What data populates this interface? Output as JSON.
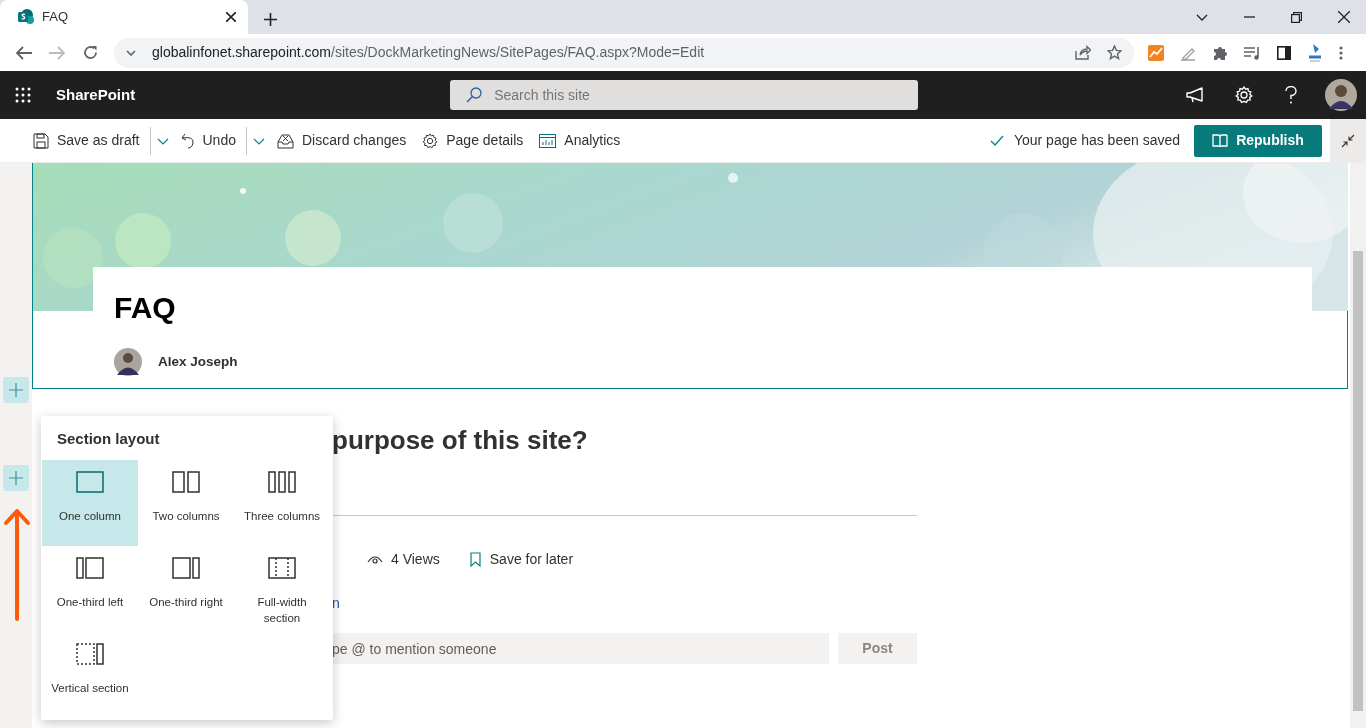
{
  "browser": {
    "tab_title": "FAQ",
    "url": "globalinfonet.sharepoint.com/sites/DockMarketingNews/SitePages/FAQ.aspx?Mode=Edit"
  },
  "suite_bar": {
    "app_name": "SharePoint",
    "search": {
      "placeholder": "Search this site"
    }
  },
  "command_bar": {
    "commands": [
      {
        "label": "Save as draft",
        "has_dropdown": true
      },
      {
        "label": "Undo",
        "has_dropdown": true
      },
      {
        "label": "Discard changes",
        "has_dropdown": false
      },
      {
        "label": "Page details",
        "has_dropdown": false
      },
      {
        "label": "Analytics",
        "has_dropdown": false
      }
    ],
    "status": "Your page has been saved",
    "primary_button": "Republish"
  },
  "page": {
    "title": "FAQ",
    "author": "Alex Joseph",
    "heading": "purpose of this site?",
    "views": "4 Views",
    "save_for_later": "Save for later",
    "link": "n",
    "comment": {
      "placeholder": "pe @ to mention someone"
    },
    "post_button": {
      "label": "Post",
      "disabled": true
    }
  },
  "section_layout": {
    "title": "Section layout",
    "options": [
      {
        "label": "One column",
        "selected": true
      },
      {
        "label": "Two columns",
        "selected": false
      },
      {
        "label": "Three columns",
        "selected": false
      },
      {
        "label": "One-third left",
        "selected": false
      },
      {
        "label": "One-third right",
        "selected": false
      },
      {
        "label": "Full-width section",
        "selected": false
      },
      {
        "label": "Vertical section",
        "selected": false
      }
    ]
  }
}
